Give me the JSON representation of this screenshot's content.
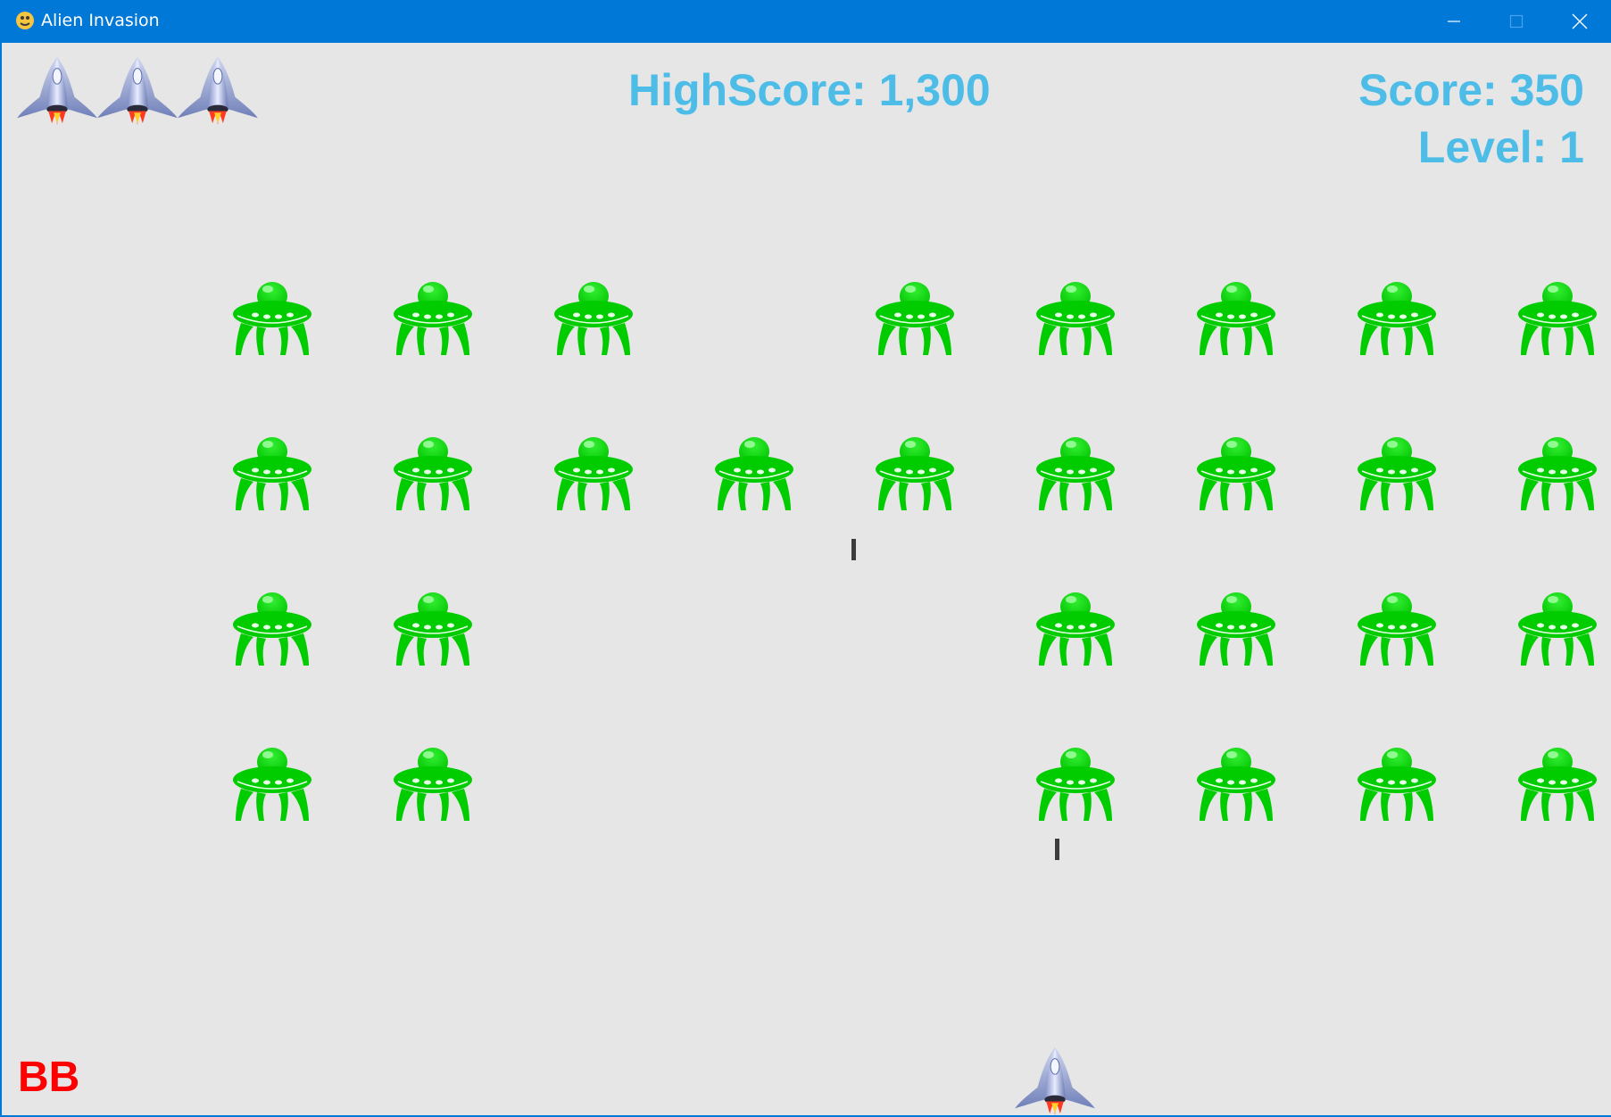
{
  "window": {
    "title": "Alien Invasion",
    "app_icon": "pygame-snake-icon",
    "controls": [
      "minimize-icon",
      "maximize-icon",
      "close-icon"
    ],
    "accent_color": "#0078d7"
  },
  "hud": {
    "high_score": "HighScore: 1,300",
    "score": "Score: 350",
    "level": "Level: 1",
    "text_color": "#4dbde8"
  },
  "player": {
    "initials": "BB",
    "initials_color": "#ff0000",
    "lives_remaining": 3
  },
  "aliens": {
    "color": "#00cc00",
    "rows": [
      [
        1,
        1,
        1,
        0,
        1,
        1,
        1,
        1,
        1
      ],
      [
        1,
        1,
        1,
        1,
        1,
        1,
        1,
        1,
        1
      ],
      [
        1,
        1,
        0,
        0,
        0,
        1,
        1,
        1,
        1
      ],
      [
        1,
        1,
        0,
        0,
        0,
        1,
        1,
        1,
        1
      ]
    ]
  },
  "bullets": {
    "count": 2,
    "color": "#3c3c3c"
  },
  "background_color": "#e6e6e6"
}
